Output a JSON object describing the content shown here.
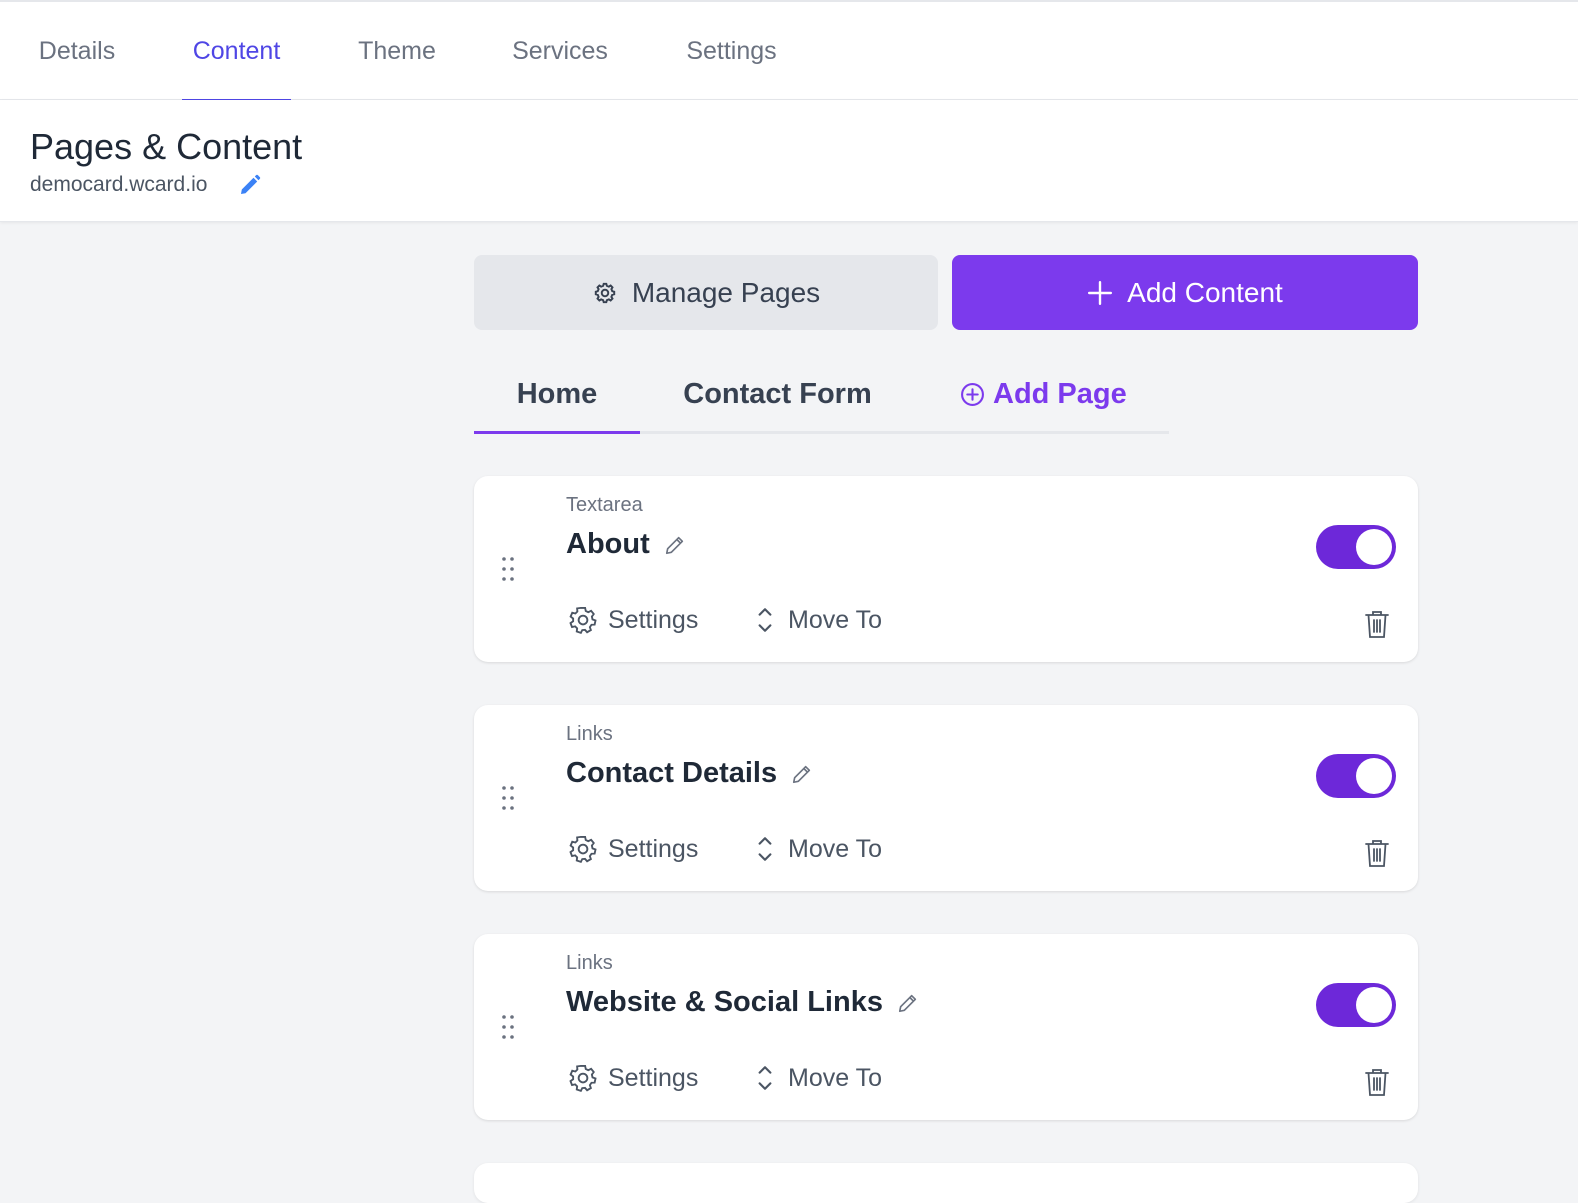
{
  "top_nav": {
    "tabs": [
      {
        "label": "Details"
      },
      {
        "label": "Content"
      },
      {
        "label": "Theme"
      },
      {
        "label": "Services"
      },
      {
        "label": "Settings"
      }
    ],
    "active_tab": "Content"
  },
  "header": {
    "title": "Pages & Content",
    "subdomain": "democard.wcard.io"
  },
  "toolbar": {
    "manage_pages_label": "Manage Pages",
    "add_content_label": "Add Content"
  },
  "page_tabs": {
    "tabs": [
      {
        "label": "Home"
      },
      {
        "label": "Contact Form"
      }
    ],
    "active_tab": "Home",
    "add_page_label": "Add Page"
  },
  "content_blocks": [
    {
      "type": "Textarea",
      "title": "About",
      "enabled": true,
      "settings_label": "Settings",
      "move_label": "Move To"
    },
    {
      "type": "Links",
      "title": "Contact Details",
      "enabled": true,
      "settings_label": "Settings",
      "move_label": "Move To"
    },
    {
      "type": "Links",
      "title": "Website & Social Links",
      "enabled": true,
      "settings_label": "Settings",
      "move_label": "Move To"
    }
  ],
  "colors": {
    "accent": "#7c3aed",
    "nav_active": "#4f46e5",
    "toggle_on": "#6d28d9",
    "background": "#f3f4f6"
  },
  "icons": {
    "manage_pages": "gear-icon",
    "add_content": "plus-icon",
    "add_page": "plus-circle-icon",
    "edit": "pencil-icon",
    "drag": "drag-handle-icon",
    "settings": "gear-icon",
    "move": "chevron-up-down-icon",
    "delete": "trash-icon"
  }
}
